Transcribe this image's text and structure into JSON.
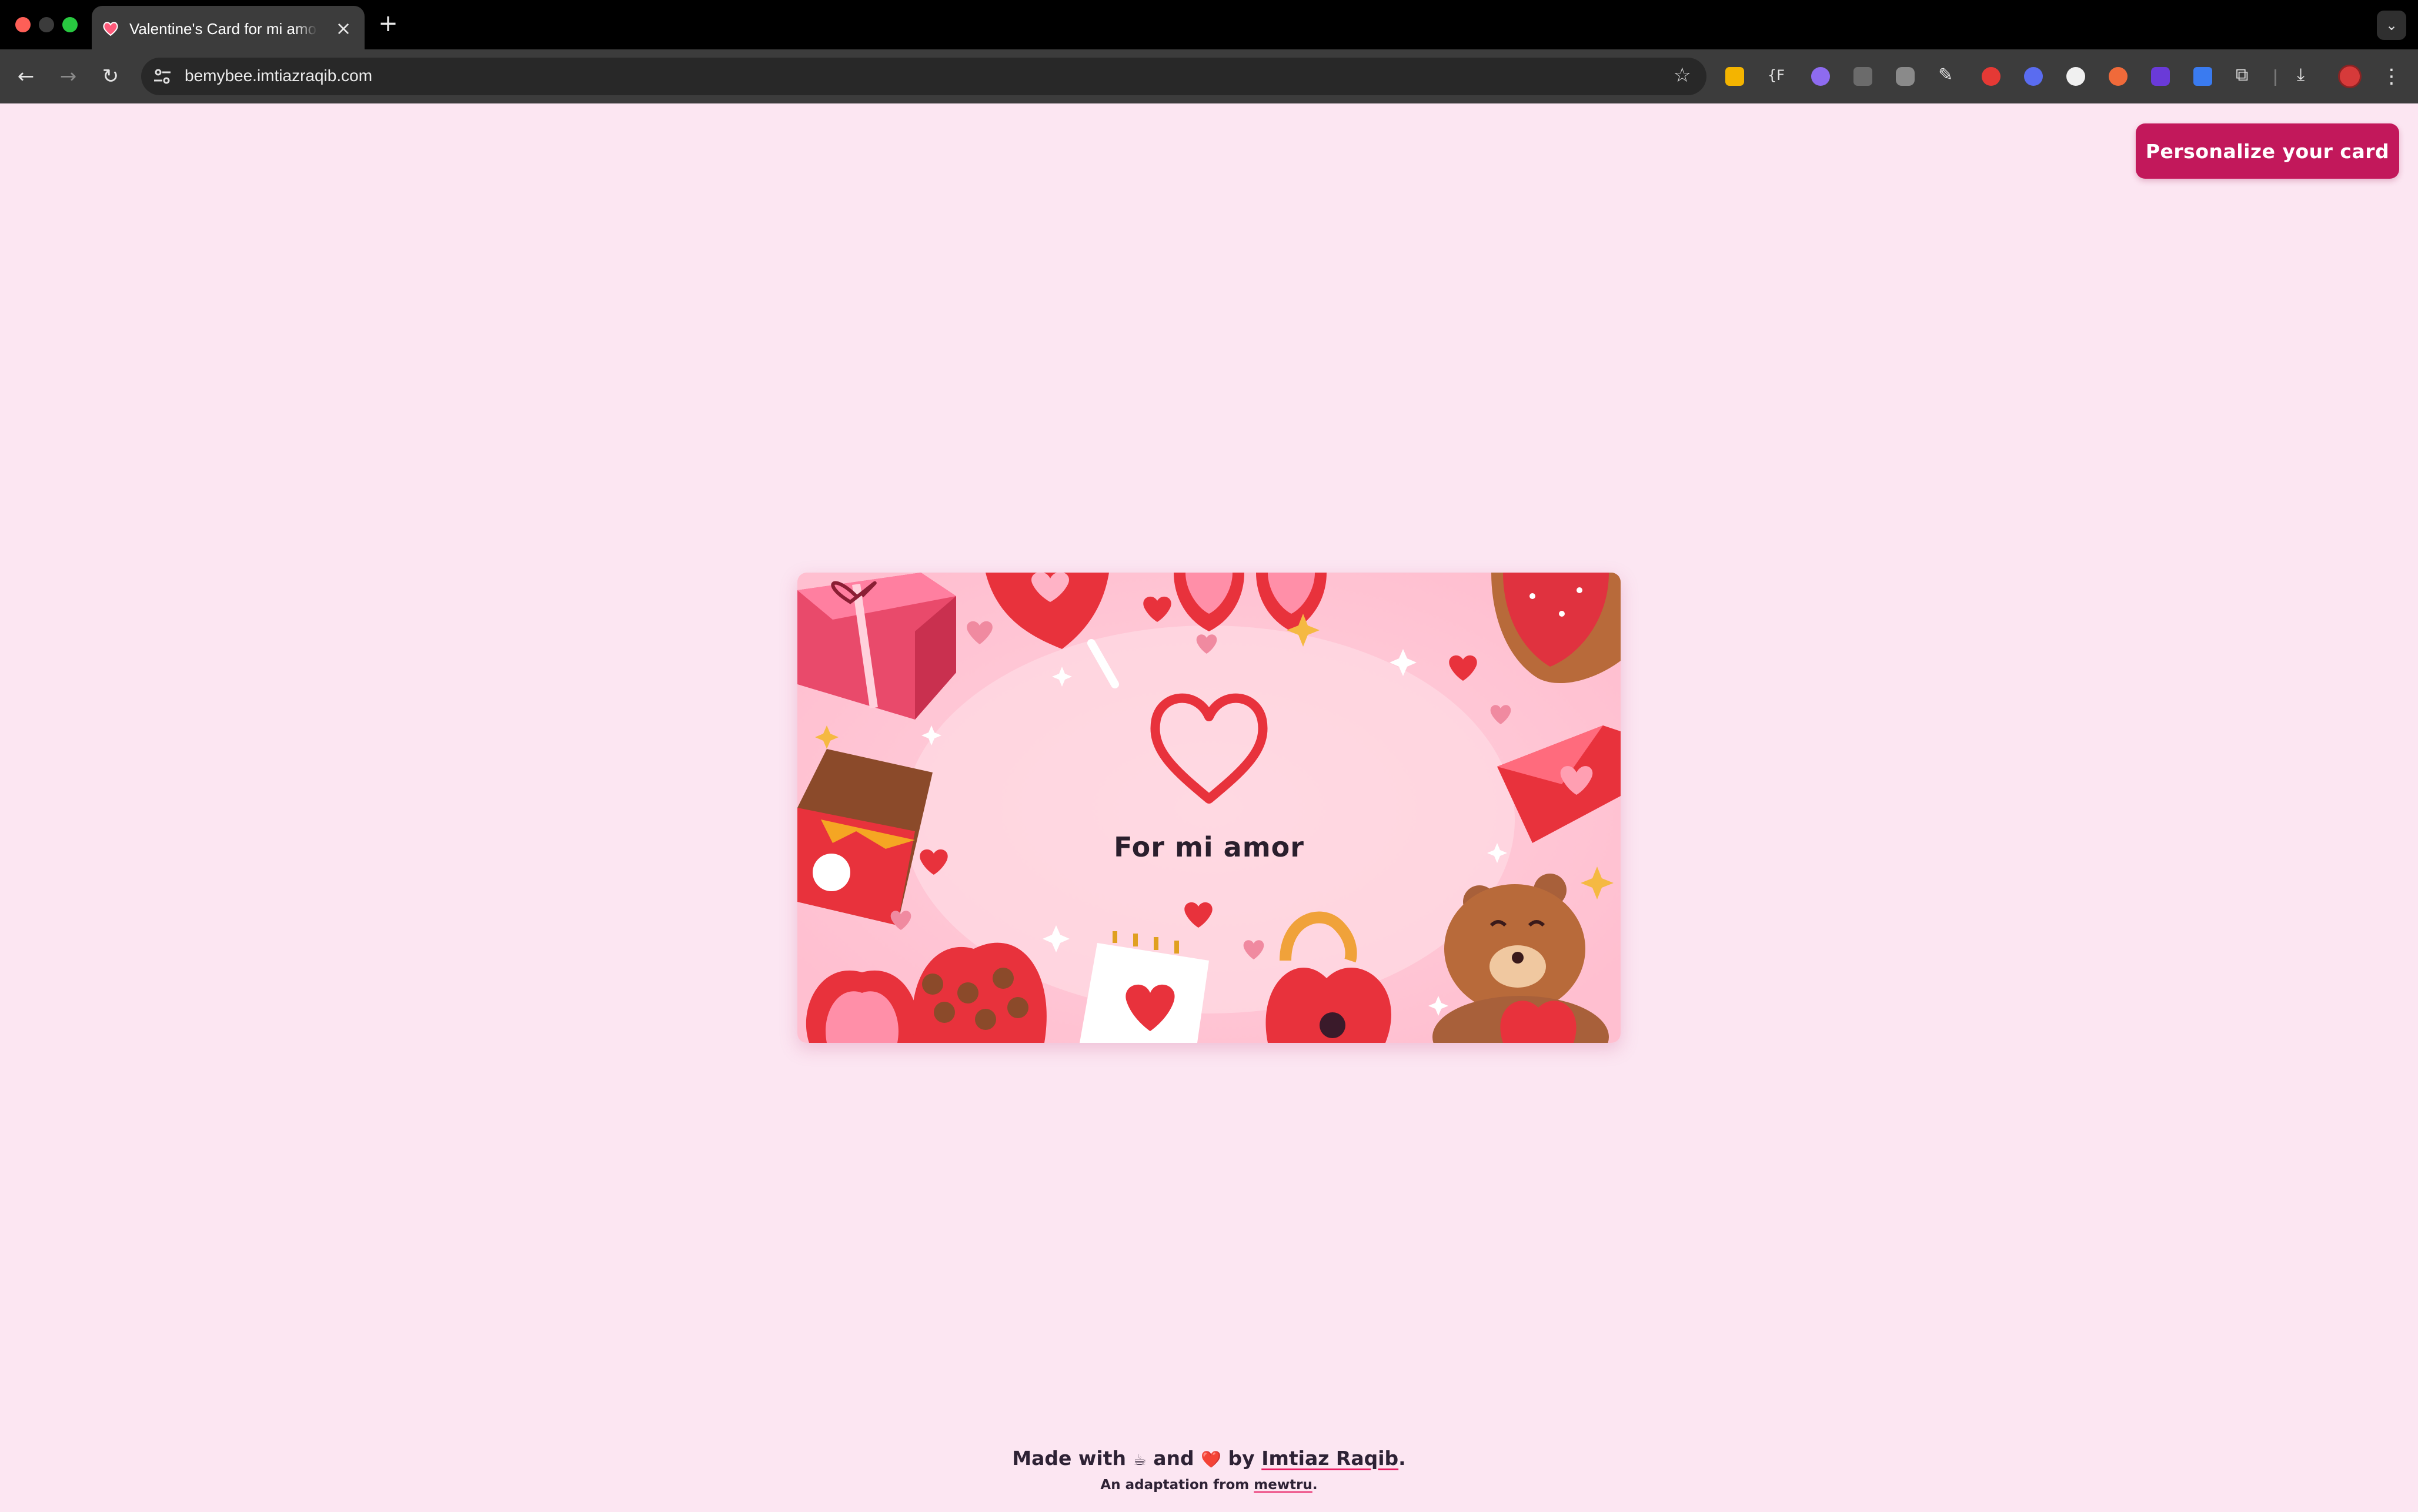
{
  "browser": {
    "tab_title": "Valentine's Card for mi amor",
    "url": "bemybee.imtiazraqib.com",
    "extensions": [
      "tag-extension-icon",
      "bracket-f-extension-icon",
      "purple-gem-extension-icon",
      "code-extension-icon",
      "camera-extension-icon",
      "eyedropper-extension-icon",
      "red-drop-extension-icon",
      "gear-blue-extension-icon",
      "circle-extension-icon",
      "orange-extension-icon",
      "purple-square-extension-icon",
      "blue-frame-extension-icon",
      "puzzle-extension-icon"
    ]
  },
  "page": {
    "personalize_label": "Personalize your card",
    "card_title": "For mi amor",
    "footer": {
      "made_with": "Made with",
      "coffee": "☕",
      "and": "and",
      "heart": "❤️",
      "by": "by",
      "author": "Imtiaz Raqib",
      "period": ".",
      "adaptation_prefix": "An adaptation from",
      "adaptation_source": "mewtru",
      "adaptation_suffix": "."
    }
  },
  "colors": {
    "page_bg": "#fce6f2",
    "accent": "#c2185b",
    "card_bg": "#ffc9d8",
    "heart_red": "#e8323c"
  }
}
